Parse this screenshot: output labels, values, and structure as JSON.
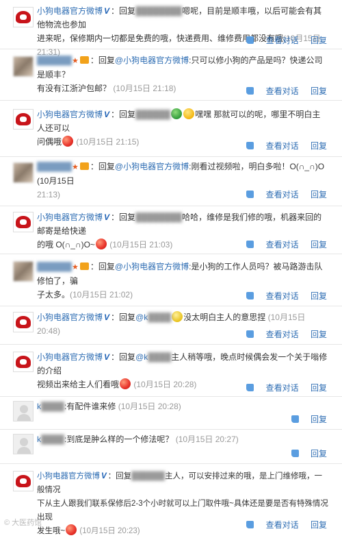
{
  "brand_name": "小狗电器官方微博",
  "actions": {
    "view_conversation": "查看对话",
    "reply": "回复"
  },
  "comments": [
    {
      "avatar": "brand",
      "author": "小狗电器官方微博",
      "prefix": "回复",
      "target": "",
      "text_line1": "嗯呢，目前是顺丰哦，以后可能会有其他物流也参加",
      "text_line2": "进来呢，保修期内一切都是免费的哦，快递费用、维修费用都没有哦",
      "time": "(10月15日 21:31)"
    },
    {
      "avatar": "user",
      "author": "",
      "prefix": "回复",
      "target": "@小狗电器官方微博",
      "text_line1": ":只可以修小狗的产品是吗？快递公司是顺丰？",
      "text_line2": "有没有江浙沪包邮？",
      "time": "(10月15日 21:18)"
    },
    {
      "avatar": "brand",
      "author": "小狗电器官方微博",
      "prefix": "回复",
      "target": "",
      "text_line1": "嘿嘿 那就可以的呢，哪里不明白主人还可以",
      "text_line2": "问偶哦",
      "time": "(10月15日 21:15)"
    },
    {
      "avatar": "user",
      "author": "",
      "prefix": "回复",
      "target": "@小狗电器官方微博",
      "text_line1": ":刚看过视频啦，明白多啦！O(∩_∩)O (10月15日",
      "text_line2": "21:13)",
      "time": ""
    },
    {
      "avatar": "brand",
      "author": "小狗电器官方微博",
      "prefix": "回复",
      "target": "",
      "text_line1": "哈哈，维修是我们修的哦，机器来回的邮寄是给快递",
      "text_line2": "的哦 O(∩_∩)O~",
      "time": "(10月15日 21:03)"
    },
    {
      "avatar": "user",
      "author": "",
      "prefix": "回复",
      "target": "@小狗电器官方微博",
      "text_line1": ":是小狗的工作人员吗？被马路游击队修怕了，骗",
      "text_line2": "子太多。",
      "time": "(10月15日 21:02)"
    },
    {
      "avatar": "brand",
      "author": "小狗电器官方微博",
      "prefix": "回复",
      "target": "@k",
      "text_line1": "没太明白主人的意思捏",
      "text_line2": "",
      "time": "(10月15日 20:48)"
    },
    {
      "avatar": "brand",
      "author": "小狗电器官方微博",
      "prefix": "回复",
      "target": "@k",
      "text_line1": "主人稍等哦，晚点时候偶会发一个关于嗡修的介绍",
      "text_line2": "视频出来给主人们看哦",
      "time": "(10月15日 20:28)"
    },
    {
      "avatar": "gray",
      "author": "k",
      "prefix": "",
      "target": "",
      "text_line1": ":有配件谁来修",
      "text_line2": "",
      "time": "(10月15日 20:28)"
    },
    {
      "avatar": "gray",
      "author": "k",
      "prefix": "",
      "target": "",
      "text_line1": ":到底是肿么样的一个修法呢？",
      "text_line2": "",
      "time": "(10月15日 20:27)"
    },
    {
      "avatar": "brand",
      "author": "小狗电器官方微博",
      "prefix": "回复",
      "target": "",
      "text_line1": "主人，可以安排过来的哦，是上门维修哦，一般情况",
      "text_line2": "下从主人跟我们联系保修后2-3个小时就可以上门取件哦~具体还是要是否有特殊情况出现",
      "text_line3": "发生哦~",
      "time": "(10月15日 20:23)"
    }
  ],
  "watermark": "© 大医药馆"
}
